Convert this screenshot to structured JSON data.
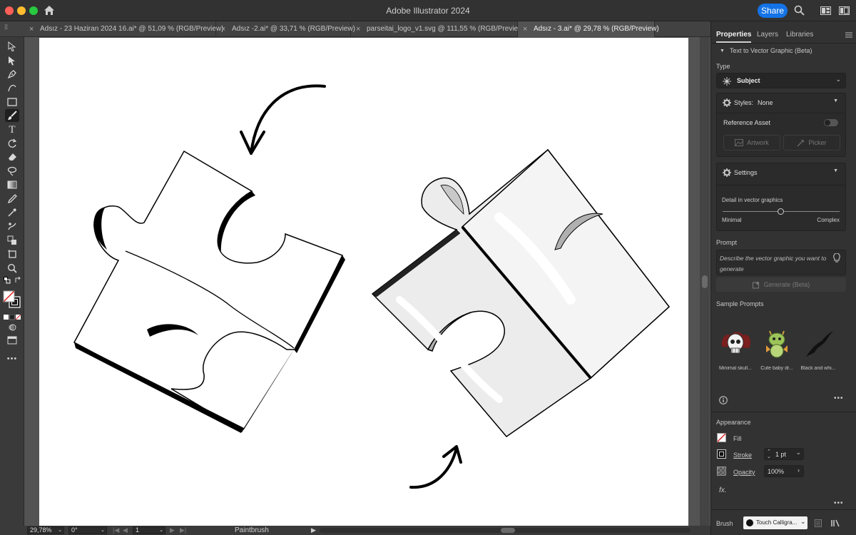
{
  "app": {
    "title": "Adobe Illustrator 2024",
    "share_label": "Share"
  },
  "colors": {
    "accent": "#1473e6",
    "close": "#fe5f57",
    "minimize": "#febc2e",
    "maximize": "#28c840"
  },
  "tabs": [
    {
      "label": "Adsız - 23 Haziran 2024 16.ai* @ 51,09 % (RGB/Preview)",
      "active": false
    },
    {
      "label": "Adsız -2.ai* @ 33,71 % (RGB/Preview)",
      "active": false
    },
    {
      "label": "parseitai_logo_v1.svg @ 111,55 % (RGB/Preview)",
      "active": false
    },
    {
      "label": "Adsız - 3.ai* @ 29,78 % (RGB/Preview)",
      "active": true
    }
  ],
  "status": {
    "zoom": "29,78%",
    "rotation": "0°",
    "artboard": "1",
    "tool": "Paintbrush"
  },
  "panel": {
    "tabs": [
      "Properties",
      "Layers",
      "Libraries"
    ],
    "section_title": "Text to Vector Graphic (Beta)",
    "type_label": "Type",
    "type_value": "Subject",
    "styles_label": "Styles:",
    "styles_value": "None",
    "reference_label": "Reference Asset",
    "artwork_label": "Artwork",
    "picker_label": "Picker",
    "settings_label": "Settings",
    "detail_label": "Detail in vector graphics",
    "detail_min": "Minimal",
    "detail_max": "Complex",
    "detail_value": 0.5,
    "prompt_label": "Prompt",
    "prompt_placeholder": "Describe the vector graphic you want to generate",
    "generate_label": "Generate (Beta)",
    "samples_label": "Sample Prompts",
    "samples": [
      {
        "caption": "Minimal skull..."
      },
      {
        "caption": "Cute baby dr..."
      },
      {
        "caption": "Black and whi..."
      }
    ],
    "appearance_label": "Appearance",
    "fill_label": "Fill",
    "stroke_label": "Stroke",
    "stroke_value": "1 pt",
    "opacity_label": "Opacity",
    "opacity_value": "100%",
    "fx_label": "fx.",
    "brush_label": "Brush",
    "brush_value": "Touch Calligra..."
  }
}
